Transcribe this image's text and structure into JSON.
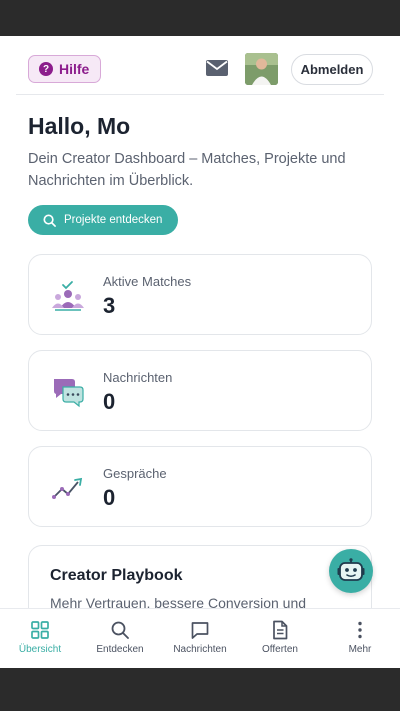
{
  "header": {
    "help_label": "Hilfe",
    "logout_label": "Abmelden"
  },
  "greeting": "Hallo, Mo",
  "intro": "Dein Creator Dashboard – Matches, Projekte und Nachrichten im Überblick.",
  "discover_label": "Projekte entdecken",
  "stats": [
    {
      "label": "Aktive Matches",
      "value": "3",
      "icon": "matches-icon"
    },
    {
      "label": "Nachrichten",
      "value": "0",
      "icon": "chat-bubbles-icon"
    },
    {
      "label": "Gespräche",
      "value": "0",
      "icon": "trend-icon"
    }
  ],
  "playbook": {
    "title": "Creator Playbook",
    "subtitle": "Mehr Vertrauen, bessere Conversion und"
  },
  "tabs": [
    {
      "label": "Übersicht",
      "icon": "grid-icon",
      "active": true
    },
    {
      "label": "Entdecken",
      "icon": "search-icon",
      "active": false
    },
    {
      "label": "Nachrichten",
      "icon": "message-icon",
      "active": false
    },
    {
      "label": "Offerten",
      "icon": "document-icon",
      "active": false
    },
    {
      "label": "Mehr",
      "icon": "more-icon",
      "active": false
    }
  ],
  "colors": {
    "accent": "#3aaea5",
    "help": "#8c1d8c"
  }
}
